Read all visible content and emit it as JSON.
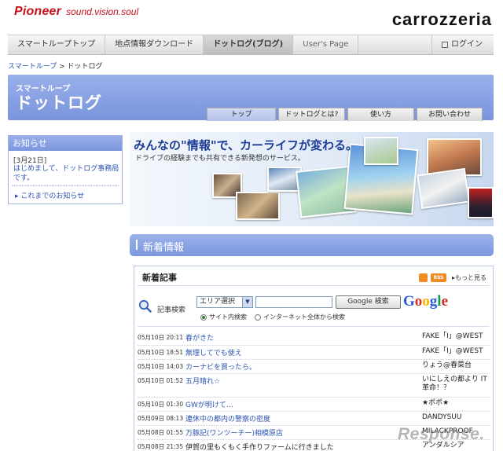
{
  "header": {
    "brand_logo": "Pioneer",
    "brand_tagline": "sound.vision.soul",
    "product_logo": "carrozzeria"
  },
  "nav": {
    "items": [
      {
        "label": "スマートループトップ",
        "active": false
      },
      {
        "label": "地点情報ダウンロード",
        "active": false
      },
      {
        "label": "ドットログ(ブログ)",
        "active": true
      },
      {
        "label": "User's Page",
        "active": false
      }
    ],
    "login_label": "ログイン"
  },
  "breadcrumb": {
    "parent": "スマートループ",
    "separator": ">",
    "current": "ドットログ"
  },
  "banner": {
    "subtitle": "スマートループ",
    "title": "ドットログ",
    "tabs": [
      {
        "label": "トップ",
        "active": true
      },
      {
        "label": "ドットログとは?",
        "active": false
      },
      {
        "label": "使い方",
        "active": false
      },
      {
        "label": "お問い合わせ",
        "active": false
      }
    ]
  },
  "notice": {
    "heading": "お知らせ",
    "date": "[3月21日]",
    "body": "はじめまして、ドットログ事務局です。",
    "archive_link": "これまでのお知らせ"
  },
  "hero": {
    "headline": "みんなの\"情報\"で、カーライフが変わる。",
    "subline": "ドライブの経験までも共有できる新発想のサービス。"
  },
  "news": {
    "heading": "新着情報",
    "box_title": "新着記事",
    "rss_label": "RSS",
    "more_link": "もっと見る"
  },
  "search": {
    "label": "記事検索",
    "area_select": "エリア選択",
    "input_value": "",
    "button": "Google 検索",
    "google_logo": "Google",
    "radio_site": "サイト内検索",
    "radio_web": "インターネット全体から検索"
  },
  "articles": [
    {
      "date": "05月10日 20:11",
      "title": "春がきた",
      "author": "FAKE「I」@WEST"
    },
    {
      "date": "05月10日 18:51",
      "title": "無理してでも使え",
      "author": "FAKE「I」@WEST"
    },
    {
      "date": "05月10日 14:03",
      "title": "カーナビを買ったら。",
      "author": "りょう@春菜台"
    },
    {
      "date": "05月10日 01:52",
      "title": "五月晴れ☆",
      "author": "いにしえの都より IT革命！？"
    },
    {
      "date": "05月10日 01:30",
      "title": "GWが明けて…",
      "author": "★ポポ★"
    },
    {
      "date": "05月09日 08:13",
      "title": "連休中の都内の警察の密度",
      "author": "DANDYSUU"
    },
    {
      "date": "05月08日 01:55",
      "title": "万豚記(ワンツーチー)相模原店",
      "author": "MILACKPROOF"
    },
    {
      "date": "05月08日 21:35",
      "title": "伊賀の里もくもく手作りファームに行きました",
      "author": "アンダルシア"
    }
  ],
  "watermark": "Response.",
  "colors": {
    "brand_red": "#c8101d",
    "banner_blue": "#8aa2e4",
    "link_blue": "#2a54b2"
  }
}
